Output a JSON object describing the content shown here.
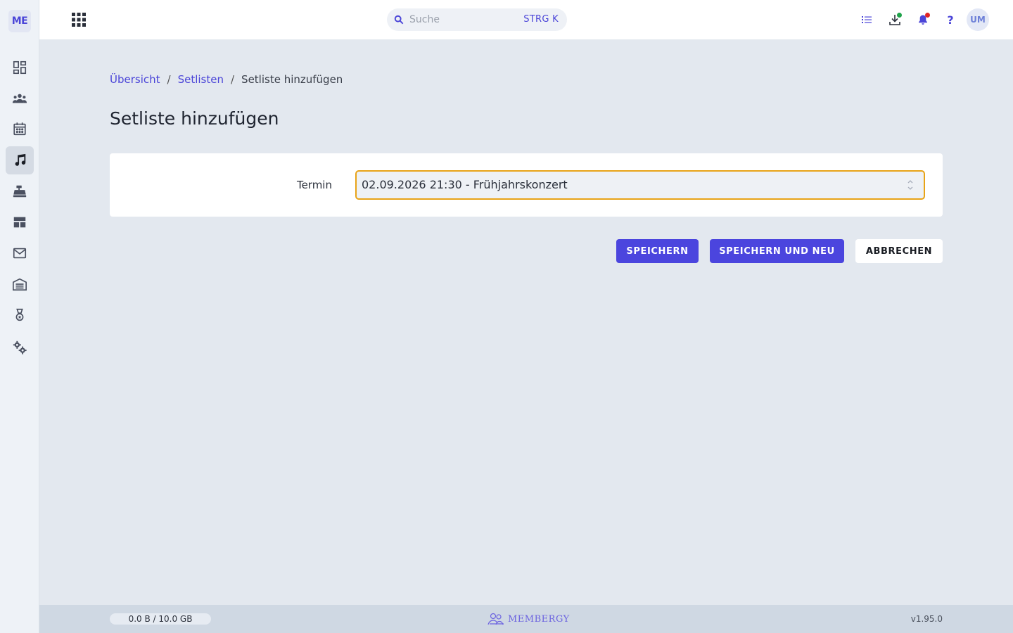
{
  "sidebar": {
    "logo": "ME",
    "items": [
      {
        "name": "dashboard-icon"
      },
      {
        "name": "members-icon"
      },
      {
        "name": "calendar-icon"
      },
      {
        "name": "music-note-icon",
        "active": true
      },
      {
        "name": "cash-register-icon"
      },
      {
        "name": "table-layout-icon"
      },
      {
        "name": "mail-icon"
      },
      {
        "name": "warehouse-icon"
      },
      {
        "name": "medal-icon"
      },
      {
        "name": "settings-icon"
      }
    ]
  },
  "topbar": {
    "search": {
      "placeholder": "Suche",
      "shortcut": "STRG K"
    },
    "help": "?",
    "avatar": "UM",
    "icons": [
      "list-icon",
      "download-icon",
      "bell-icon",
      "help-icon"
    ],
    "status_colors": {
      "download_dot": "#1fa34a",
      "bell_dot": "#e02424"
    }
  },
  "breadcrumb": {
    "items": [
      {
        "label": "Übersicht"
      },
      {
        "label": "Setlisten"
      }
    ],
    "separator": "/",
    "current": "Setliste hinzufügen"
  },
  "page": {
    "title": "Setliste hinzufügen"
  },
  "form": {
    "termin_label": "Termin",
    "termin_value": "02.09.2026 21:30 - Frühjahrskonzert"
  },
  "actions": {
    "save": "SPEICHERN",
    "save_and_new": "SPEICHERN UND NEU",
    "cancel": "ABBRECHEN"
  },
  "footer": {
    "storage": "0.0 B / 10.0 GB",
    "brand": "MEMBERGY",
    "version": "v1.95.0"
  },
  "colors": {
    "accent": "#4b45de",
    "focus_border": "#e8a317",
    "background": "#e3e8ef"
  }
}
